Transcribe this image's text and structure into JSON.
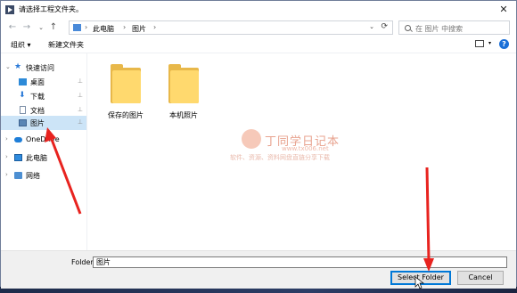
{
  "window": {
    "title": "请选择工程文件夹。",
    "close_glyph": "✕"
  },
  "nav": {
    "back": "←",
    "forward": "→",
    "dropdown": "⌄",
    "up": "↑"
  },
  "address": {
    "breadcrumb": [
      "此电脑",
      "图片"
    ],
    "separators": [
      "›",
      "›",
      "›"
    ]
  },
  "search": {
    "placeholder": "在 图片 中搜索"
  },
  "toolbar": {
    "organize": "组织 ▾",
    "new_folder": "新建文件夹",
    "help": "?"
  },
  "sidebar": {
    "items": [
      {
        "label": "快速访问",
        "icon": "star-icon",
        "chev": "⌄"
      },
      {
        "label": "桌面",
        "icon": "desktop-icon",
        "pin": "📌"
      },
      {
        "label": "下载",
        "icon": "download-icon",
        "pin": "📌"
      },
      {
        "label": "文档",
        "icon": "document-icon",
        "pin": "📌"
      },
      {
        "label": "图片",
        "icon": "pictures-icon",
        "pin": "📌"
      },
      {
        "label": "OneDrive",
        "icon": "cloud-icon",
        "chev": "›"
      },
      {
        "label": "此电脑",
        "icon": "computer-icon",
        "chev": "›"
      },
      {
        "label": "网络",
        "icon": "network-icon",
        "chev": "›"
      }
    ]
  },
  "content": {
    "folders": [
      {
        "name": "保存的图片"
      },
      {
        "name": "本机照片"
      }
    ]
  },
  "watermark": {
    "title": "丁同学日记本",
    "url": "www.tx006.net",
    "subtitle": "软件、资源、资料网盘直链分享下载"
  },
  "bottom": {
    "folder_label": "Folder:",
    "folder_value": "图片",
    "select_label": "Select Folder",
    "cancel_label": "Cancel"
  },
  "colors": {
    "accent": "#0078d7",
    "arrow": "#e8231f",
    "selection": "#cce4f7"
  }
}
